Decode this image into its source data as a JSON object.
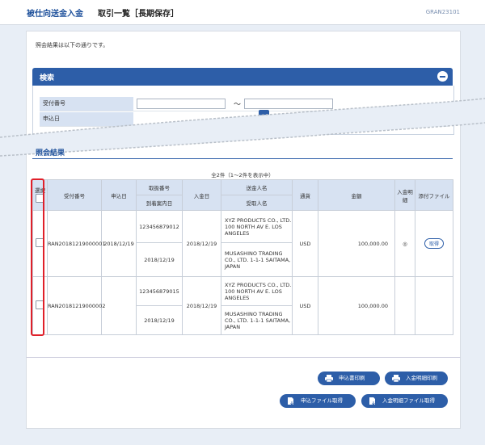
{
  "header": {
    "app_title": "被仕向送金入金",
    "page_title": "取引一覧［長期保存］",
    "screen_code": "GRAN23101"
  },
  "message": "照会結果は以下の通りです。",
  "search": {
    "title": "検索",
    "fields": [
      {
        "label": "受付番号",
        "range_sep": "～"
      },
      {
        "label": "申込日"
      }
    ]
  },
  "results": {
    "title": "照会結果",
    "count": "全2件（1～2件を表示中）",
    "headers": {
      "select": "選択",
      "receipt_no": "受付番号",
      "apply_date": "申込日",
      "handling_no": "取扱番号",
      "arrival_date": "到着案内日",
      "deposit_date": "入金日",
      "sender": "送金人名",
      "receiver": "受取人名",
      "currency": "通貨",
      "amount": "金額",
      "deposit_detail": "入金明細",
      "attachment": "添付ファイル"
    },
    "rows": [
      {
        "receipt_no": "RAN20181219000001",
        "apply_date": "2018/12/19",
        "handling_no": "123456879012",
        "arrival_date": "2018/12/19",
        "deposit_date": "2018/12/19",
        "sender": "XYZ PRODUCTS CO., LTD. 100 NORTH AV E. LOS ANGELES",
        "receiver": "MUSASHINO TRADING CO., LTD. 1-1-1 SAITAMA, JAPAN",
        "currency": "USD",
        "amount": "100,000.00",
        "deposit_detail": "◎",
        "attachment": "取得"
      },
      {
        "receipt_no": "RAN20181219000002",
        "apply_date": "",
        "handling_no": "123456879015",
        "arrival_date": "2018/12/19",
        "deposit_date": "2018/12/19",
        "sender": "XYZ PRODUCTS CO., LTD. 100 NORTH AV E. LOS ANGELES",
        "receiver": "MUSASHINO TRADING CO., LTD. 1-1-1 SAITAMA, JAPAN",
        "currency": "USD",
        "amount": "100,000.00",
        "deposit_detail": "",
        "attachment": ""
      }
    ]
  },
  "buttons": {
    "print_application": "申込書印刷",
    "print_deposit_detail": "入金明細印刷",
    "get_application_file": "申込ファイル取得",
    "get_deposit_detail_file": "入金明細ファイル取得"
  },
  "colors": {
    "primary": "#2d5ea8",
    "highlight": "#e0202a",
    "header_bg": "#d7e2f2"
  }
}
